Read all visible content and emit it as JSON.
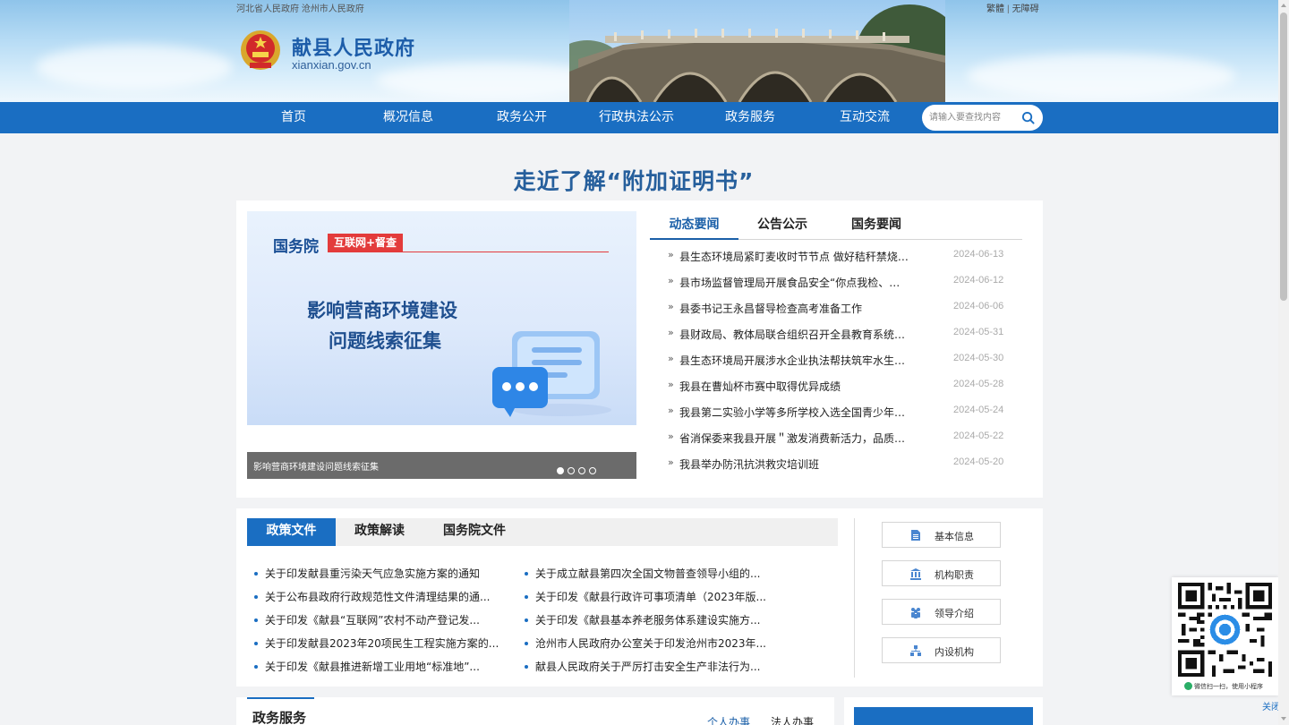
{
  "header": {
    "parent_links": "河北省人民政府  沧州市人民政府",
    "lang_links": [
      "繁體",
      "无障碍"
    ],
    "site_title": "献县人民政府",
    "site_domain": "xianxian.gov.cn"
  },
  "nav": {
    "items": [
      "首页",
      "概况信息",
      "政务公开",
      "行政执法公示",
      "政务服务",
      "互动交流"
    ],
    "search_placeholder": "请输入要查找内容"
  },
  "headline": "走近了解“附加证明书”",
  "slider": {
    "image_text": {
      "org": "国务院",
      "tag": "互联网+督查",
      "line1": "影响营商环境建设",
      "line2": "问题线索征集"
    },
    "caption": "影响营商环境建设问题线索征集",
    "dots": 4,
    "active_dot": 1
  },
  "news": {
    "tabs": [
      "动态要闻",
      "公告公示",
      "国务要闻"
    ],
    "active_tab": 0,
    "items": [
      {
        "title": "县生态环境局紧盯麦收时节节点 做好秸秆禁烧工作",
        "date": "2024-06-13"
      },
      {
        "title": "县市场监督管理局开展食品安全“你点我检、服务惠民生”活动",
        "date": "2024-06-12"
      },
      {
        "title": "县委书记王永昌督导检查高考准备工作",
        "date": "2024-06-06"
      },
      {
        "title": "县财政局、教体局联合组织召开全县教育系统财务培训会",
        "date": "2024-05-31"
      },
      {
        "title": "县生态环境局开展涉水企业执法帮扶筑牢水生态环境保护防线",
        "date": "2024-05-30"
      },
      {
        "title": "我县在曹灿杯市赛中取得优异成绩",
        "date": "2024-05-28"
      },
      {
        "title": "我县第二实验小学等多所学校入选全国青少年校园足球特色学校",
        "date": "2024-05-24"
      },
      {
        "title": "省消保委来我县开展＂激发消费新活力，品质消费进万家＂活动",
        "date": "2024-05-22"
      },
      {
        "title": "我县举办防汛抗洪救灾培训班",
        "date": "2024-05-20"
      }
    ]
  },
  "policy": {
    "tabs": [
      "政策文件",
      "政策解读",
      "国务院文件"
    ],
    "active_tab": 0,
    "left": [
      "关于印发献县重污染天气应急实施方案的通知",
      "关于公布县政府行政规范性文件清理结果的通...",
      "关于印发《献县“互联网”农村不动产登记发...",
      "关于印发献县2023年20项民生工程实施方案的...",
      "关于印发《献县推进新增工业用地“标准地”..."
    ],
    "right": [
      "关于成立献县第四次全国文物普查领导小组的...",
      "关于印发《献县行政许可事项清单（2023年版...",
      "关于印发《献县基本养老服务体系建设实施方...",
      "沧州市人民政府办公室关于印发沧州市2023年...",
      "献县人民政府关于严厉打击安全生产非法行为..."
    ]
  },
  "info_buttons": [
    {
      "label": "基本信息",
      "icon": "document-icon"
    },
    {
      "label": "机构职责",
      "icon": "building-icon"
    },
    {
      "label": "领导介绍",
      "icon": "people-icon"
    },
    {
      "label": "内设机构",
      "icon": "org-chart-icon"
    }
  ],
  "services": {
    "title": "政务服务",
    "tabs": [
      "个人办事",
      "法人办事"
    ]
  },
  "qr": {
    "caption": "微信扫一扫，使用小程序",
    "close_label": "关闭"
  },
  "colors": {
    "brand_blue": "#1a6ec2",
    "title_blue": "#1d5da9",
    "red_tag": "#e33b3b"
  }
}
